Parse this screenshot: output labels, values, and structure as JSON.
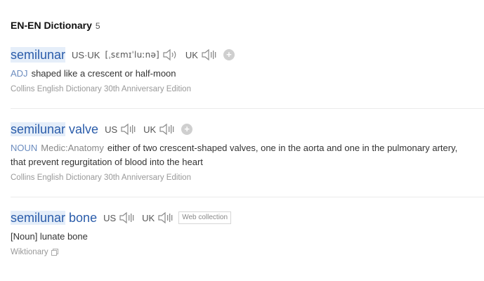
{
  "section": {
    "title": "EN-EN Dictionary",
    "count": "5"
  },
  "entries": [
    {
      "headword": "semilunar",
      "prons": [
        {
          "label": "US·UK",
          "phonetic": "[ˌsɛmɪˈluːnə]"
        },
        {
          "label": "UK",
          "phonetic": ""
        }
      ],
      "pos": "ADJ",
      "domain": "",
      "definition": "shaped like a crescent or half-moon",
      "source": "Collins English Dictionary 30th Anniversary Edition"
    },
    {
      "headword_hl": "semilunar",
      "headword_rest": " valve",
      "prons": [
        {
          "label": "US"
        },
        {
          "label": "UK"
        }
      ],
      "pos": "NOUN",
      "domain": "Medic:Anatomy",
      "definition": "either of two crescent-shaped valves, one in the aorta and one in the pulmonary artery, that prevent regurgitation of blood into the heart",
      "source": "Collins English Dictionary 30th Anniversary Edition"
    },
    {
      "headword_hl": "semilunar",
      "headword_rest": " bone",
      "prons": [
        {
          "label": "US"
        },
        {
          "label": "UK"
        }
      ],
      "badge": "Web collection",
      "definition": "[Noun] lunate bone",
      "source": "Wiktionary"
    }
  ],
  "icons": {
    "speaker": "speaker-icon",
    "add": "plus-icon",
    "copy": "copy-icon"
  },
  "colors": {
    "headword": "#2a5caa",
    "pos": "#6b8cbf",
    "highlight": "#e5eef9",
    "source": "#999999"
  }
}
